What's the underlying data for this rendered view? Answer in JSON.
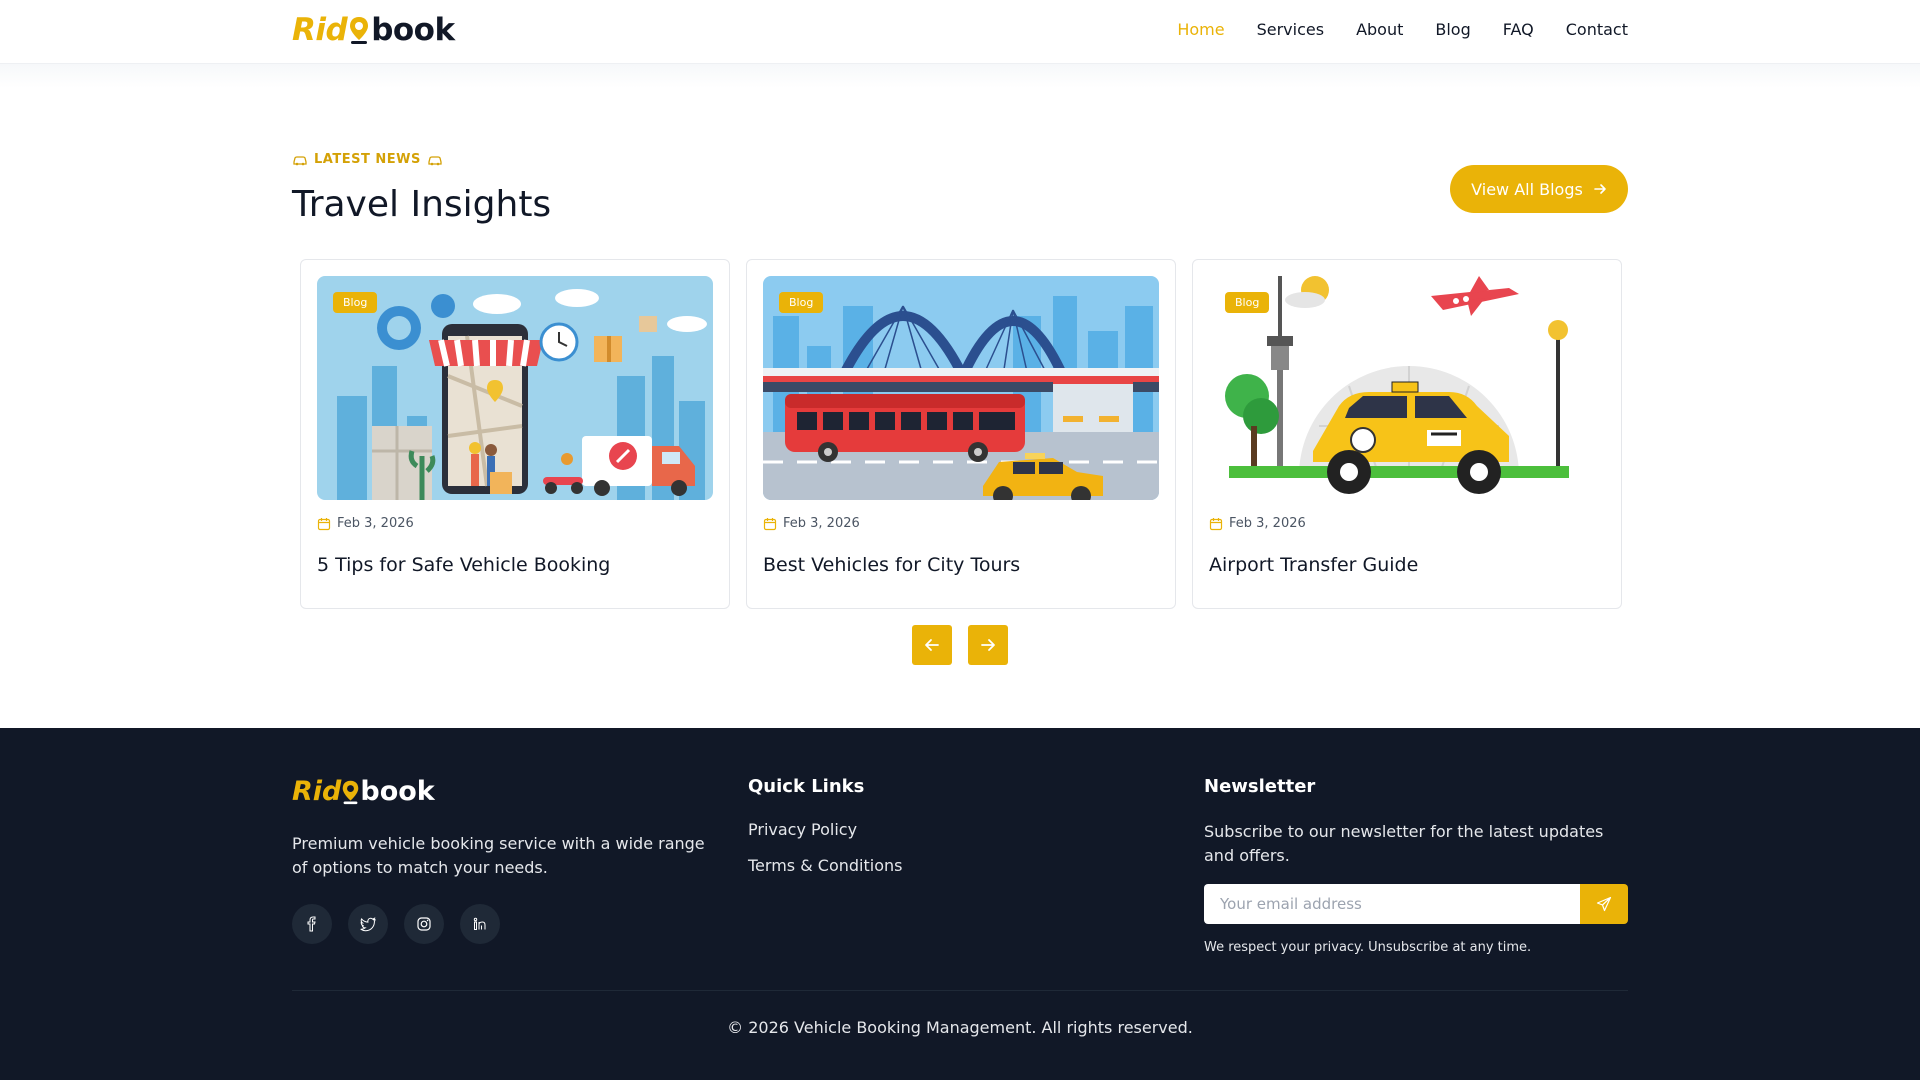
{
  "brand": {
    "part1": "Rid",
    "part2": "book",
    "accent": "#eab308",
    "dark": "#111827"
  },
  "nav": [
    {
      "label": "Home",
      "active": true
    },
    {
      "label": "Services"
    },
    {
      "label": "About"
    },
    {
      "label": "Blog"
    },
    {
      "label": "FAQ"
    },
    {
      "label": "Contact"
    }
  ],
  "section": {
    "eyebrow": "LATEST NEWS",
    "title": "Travel Insights",
    "view_all": "View All Blogs"
  },
  "cards": [
    {
      "badge": "Blog",
      "date": "Feb 3, 2026",
      "title": "5 Tips for Safe Vehicle Booking",
      "image": "city-delivery-illustration"
    },
    {
      "badge": "Blog",
      "date": "Feb 3, 2026",
      "title": "Best Vehicles for City Tours",
      "image": "red-bus-bridge-illustration"
    },
    {
      "badge": "Blog",
      "date": "Feb 3, 2026",
      "title": "Airport Transfer Guide",
      "image": "airport-taxi-illustration"
    }
  ],
  "footer": {
    "description": "Premium vehicle booking service with a wide range of options to match your needs.",
    "socials": [
      "facebook-icon",
      "twitter-icon",
      "instagram-icon",
      "linkedin-icon"
    ],
    "quick_links": {
      "heading": "Quick Links",
      "items": [
        "Privacy Policy",
        "Terms & Conditions"
      ]
    },
    "newsletter": {
      "heading": "Newsletter",
      "text": "Subscribe to our newsletter for the latest updates and offers.",
      "placeholder": "Your email address",
      "privacy": "We respect your privacy. Unsubscribe at any time."
    },
    "copyright": "© 2026 Vehicle Booking Management. All rights reserved."
  }
}
